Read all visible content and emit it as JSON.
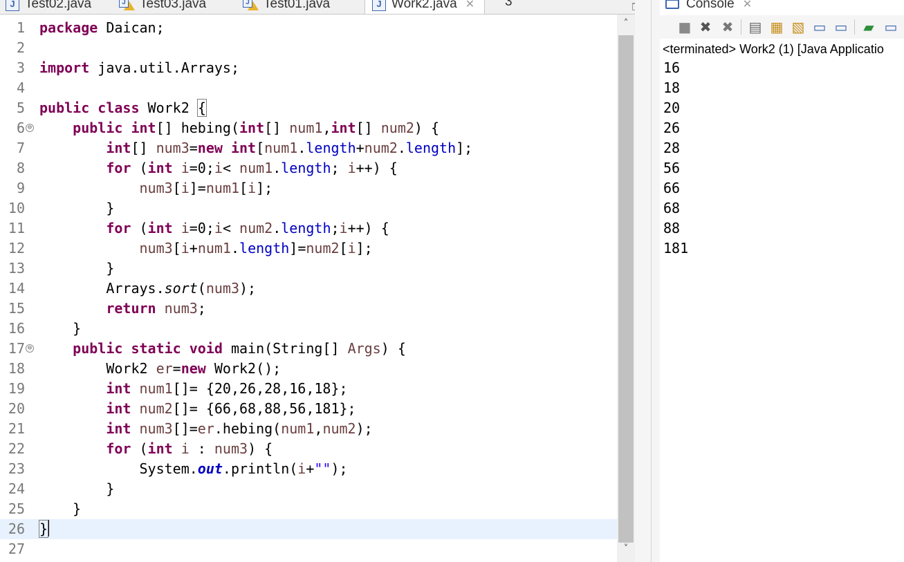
{
  "editor_tabs": [
    {
      "label": "Test02.java",
      "icon": "java-file-icon",
      "warning": false
    },
    {
      "label": "Test03.java",
      "icon": "java-file-warning-icon",
      "warning": true
    },
    {
      "label": "Test01.java",
      "icon": "java-file-warning-icon",
      "warning": true
    },
    {
      "label": "Work2.java",
      "icon": "java-file-icon",
      "warning": false,
      "active": true
    }
  ],
  "editor_tab_overflow": "3",
  "line_numbers": [
    "1",
    "2",
    "3",
    "4",
    "5",
    "6",
    "7",
    "8",
    "9",
    "10",
    "11",
    "12",
    "13",
    "14",
    "15",
    "16",
    "17",
    "18",
    "19",
    "20",
    "21",
    "22",
    "23",
    "24",
    "25",
    "26",
    "27"
  ],
  "fold_markers": {
    "line6": "⊖",
    "line17": "⊖"
  },
  "code": {
    "l1_kw": "package",
    "l1_rest": " Daican;",
    "l3_kw": "import",
    "l3_rest": " java.util.Arrays;",
    "l5_kw1": "public",
    "l5_kw2": "class",
    "l5_name": " Work2 ",
    "l5_brace": "{",
    "l6_kw1": "public",
    "l6_kw2": "int",
    "l6_a": "[] hebing(",
    "l6_kw3": "int",
    "l6_b": "[] ",
    "l6_v1": "num1",
    "l6_c": ",",
    "l6_kw4": "int",
    "l6_d": "[] ",
    "l6_v2": "num2",
    "l6_e": ") {",
    "l7_kw1": "int",
    "l7_a": "[] ",
    "l7_v1": "num3",
    "l7_b": "=",
    "l7_kw2": "new",
    "l7_kw3": "int",
    "l7_c": "[",
    "l7_v2": "num1",
    "l7_d": ".",
    "l7_f1": "length",
    "l7_e": "+",
    "l7_v3": "num2",
    "l7_g": ".",
    "l7_f2": "length",
    "l7_h": "];",
    "l8_kw1": "for",
    "l8_a": " (",
    "l8_kw2": "int",
    "l8_b": " ",
    "l8_v1": "i",
    "l8_c": "=0;",
    "l8_v2": "i",
    "l8_d": "< ",
    "l8_v3": "num1",
    "l8_e": ".",
    "l8_f": "length",
    "l8_g": "; ",
    "l8_v4": "i",
    "l8_h": "++) {",
    "l9_v1": "num3",
    "l9_a": "[",
    "l9_v2": "i",
    "l9_b": "]=",
    "l9_v3": "num1",
    "l9_c": "[",
    "l9_v4": "i",
    "l9_d": "];",
    "l10": "}",
    "l11_kw1": "for",
    "l11_a": " (",
    "l11_kw2": "int",
    "l11_b": " ",
    "l11_v1": "i",
    "l11_c": "=0;",
    "l11_v2": "i",
    "l11_d": "< ",
    "l11_v3": "num2",
    "l11_e": ".",
    "l11_f": "length",
    "l11_g": ";",
    "l11_v4": "i",
    "l11_h": "++) {",
    "l12_v1": "num3",
    "l12_a": "[",
    "l12_v2": "i",
    "l12_b": "+",
    "l12_v3": "num1",
    "l12_c": ".",
    "l12_f": "length",
    "l12_d": "]=",
    "l12_v4": "num2",
    "l12_e": "[",
    "l12_v5": "i",
    "l12_g": "];",
    "l13": "}",
    "l14_a": "Arrays.",
    "l14_m": "sort",
    "l14_b": "(",
    "l14_v": "num3",
    "l14_c": ");",
    "l15_kw": "return",
    "l15_a": " ",
    "l15_v": "num3",
    "l15_b": ";",
    "l16": "}",
    "l17_kw1": "public",
    "l17_kw2": "static",
    "l17_kw3": "void",
    "l17_a": " main(String[] ",
    "l17_v": "Args",
    "l17_b": ") {",
    "l18_a": "Work2 ",
    "l18_v": "er",
    "l18_b": "=",
    "l18_kw": "new",
    "l18_c": " Work2();",
    "l19_kw": "int",
    "l19_a": " ",
    "l19_v": "num1",
    "l19_b": "[]= {20,26,28,16,18};",
    "l20_kw": "int",
    "l20_a": " ",
    "l20_v": "num2",
    "l20_b": "[]= {66,68,88,56,181};",
    "l21_kw": "int",
    "l21_a": " ",
    "l21_v1": "num3",
    "l21_b": "[]=",
    "l21_v2": "er",
    "l21_c": ".hebing(",
    "l21_v3": "num1",
    "l21_d": ",",
    "l21_v4": "num2",
    "l21_e": ");",
    "l22_kw1": "for",
    "l22_a": " (",
    "l22_kw2": "int",
    "l22_b": " ",
    "l22_v1": "i",
    "l22_c": " : ",
    "l22_v2": "num3",
    "l22_d": ") {",
    "l23_a": "System.",
    "l23_f": "out",
    "l23_b": ".println(",
    "l23_v": "i",
    "l23_c": "+",
    "l23_s": "\"\"",
    "l23_d": ");",
    "l24": "}",
    "l25": "}",
    "l26": "}"
  },
  "scrollbar": {
    "up": "˄",
    "down": "˅"
  },
  "console": {
    "tab_label": "Console",
    "description": "<terminated> Work2 (1) [Java Applicatio",
    "output_lines": [
      "16",
      "18",
      "20",
      "26",
      "28",
      "56",
      "66",
      "68",
      "88",
      "181"
    ],
    "toolbar_icons": [
      "stop-icon",
      "remove-launch-icon",
      "remove-all-terminated-icon",
      "clear-console-icon",
      "scroll-lock-icon",
      "word-wrap-icon",
      "show-on-stdout-icon",
      "show-on-stderr-icon",
      "pin-console-icon",
      "display-selected-console-icon"
    ]
  },
  "colors": {
    "keyword": "#7f0055",
    "local_variable": "#6a3e3e",
    "field": "#0000c0",
    "string": "#2a00ff",
    "current_line": "#e8f2fe"
  }
}
